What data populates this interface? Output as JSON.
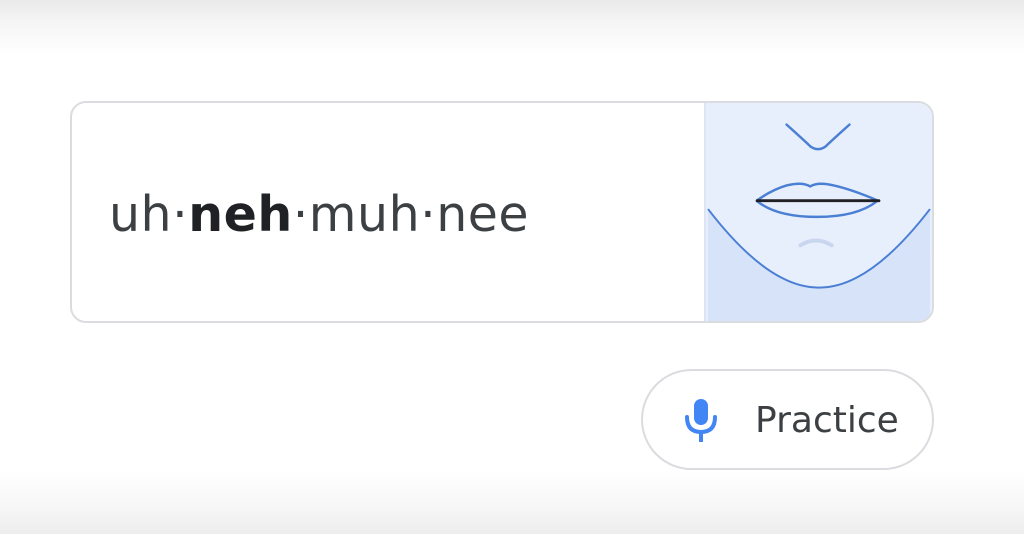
{
  "pronunciation": {
    "syllables": [
      {
        "text": "uh",
        "stressed": false
      },
      {
        "text": "neh",
        "stressed": true
      },
      {
        "text": "muh",
        "stressed": false
      },
      {
        "text": "nee",
        "stressed": false
      }
    ],
    "separator": "·"
  },
  "mouth_illustration": {
    "icon": "mouth-diagram-icon",
    "background_color": "#e8effc",
    "line_color": "#4a7fd4"
  },
  "practice_button": {
    "label": "Practice",
    "icon": "microphone-icon",
    "icon_color": "#4285f4"
  }
}
